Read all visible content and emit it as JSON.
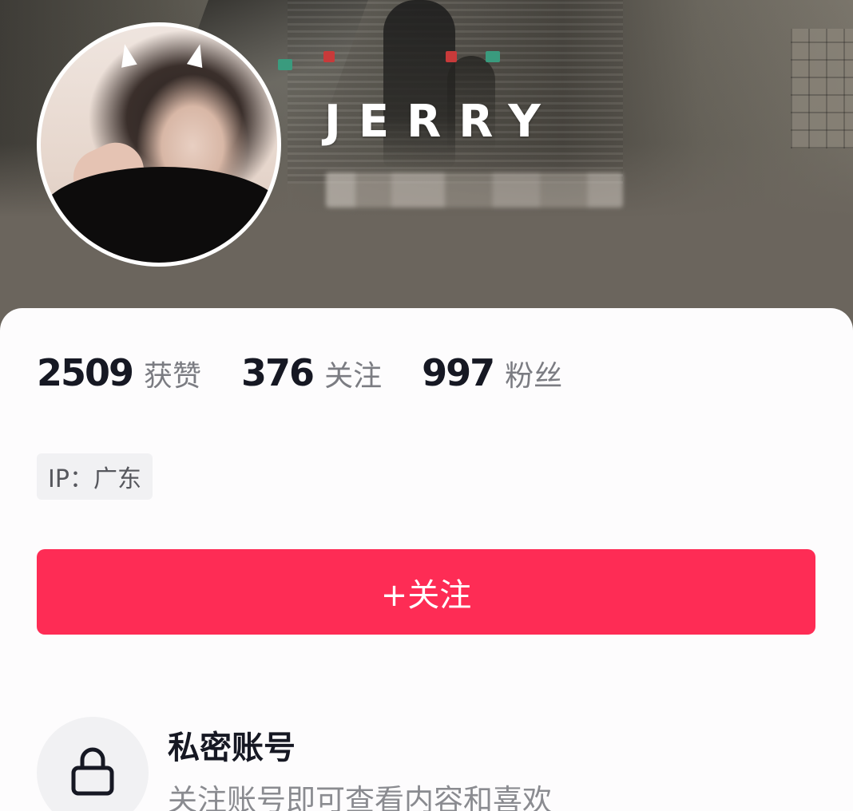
{
  "profile": {
    "username": "JERRY"
  },
  "stats": [
    {
      "value": "2509",
      "label": "获赞"
    },
    {
      "value": "376",
      "label": "关注"
    },
    {
      "value": "997",
      "label": "粉丝"
    }
  ],
  "ip_location": "IP：广东",
  "follow_button": "+关注",
  "private_account": {
    "title": "私密账号",
    "description": "关注账号即可查看内容和喜欢",
    "icon": "lock-icon"
  },
  "colors": {
    "accent": "#fe2c55",
    "header_bg": "#6b655d",
    "card_bg": "#fdfcfd",
    "primary_text": "#161823",
    "secondary_text": "#7b7c82"
  }
}
